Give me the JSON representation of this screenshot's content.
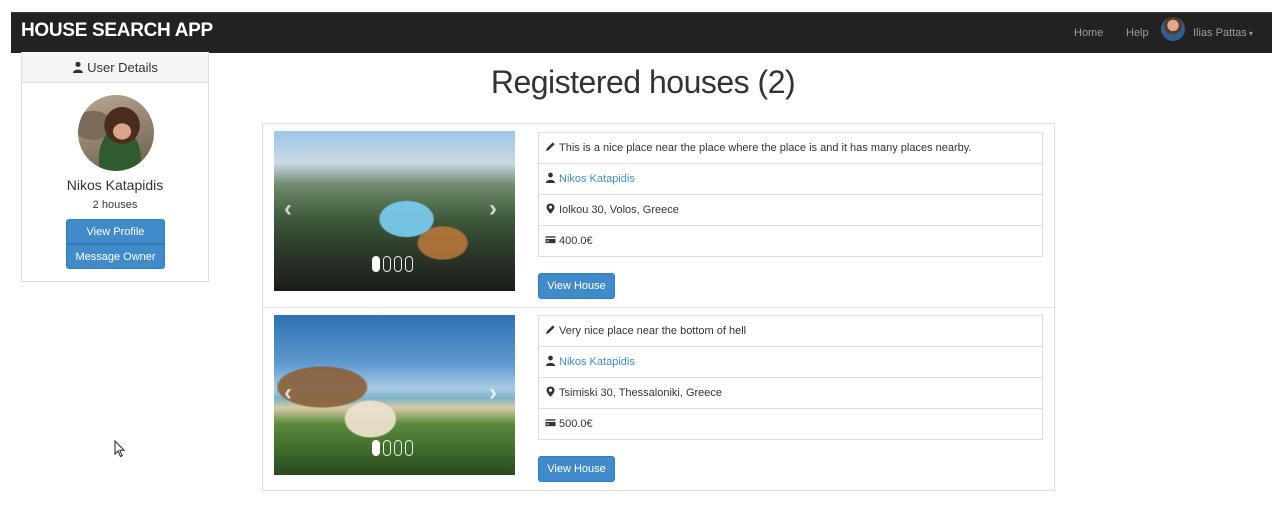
{
  "navbar": {
    "brand": "HOUSE SEARCH APP",
    "links": [
      "Home",
      "Help"
    ],
    "user_name": "Ilias Pattas",
    "caret": "▾"
  },
  "user_panel": {
    "heading": "User Details",
    "name": "Nikos Katapidis",
    "houses_count": "2 houses",
    "view_profile_label": "View Profile",
    "message_owner_label": "Message Owner"
  },
  "main": {
    "title": "Registered houses (2)"
  },
  "houses": [
    {
      "description": "This is a nice place near the place where the place is and it has many places nearby.",
      "owner": "Nikos Katapidis",
      "address": "Iolkou 30, Volos, Greece",
      "price": "400.0€",
      "view_label": "View House"
    },
    {
      "description": "Very nice place near the bottom of hell",
      "owner": "Nikos Katapidis",
      "address": "Tsimiski 30, Thessaloniki, Greece",
      "price": "500.0€",
      "view_label": "View House"
    }
  ],
  "carousel": {
    "arrow_left": "‹",
    "arrow_right": "›"
  },
  "colors": {
    "navbar": "#222222",
    "primary": "#428bca",
    "link": "#428bca"
  },
  "icons": [
    "user-icon",
    "pencil-icon",
    "map-marker-icon",
    "credit-card-icon",
    "chevron-left-icon",
    "chevron-right-icon",
    "mouse-cursor-icon"
  ]
}
